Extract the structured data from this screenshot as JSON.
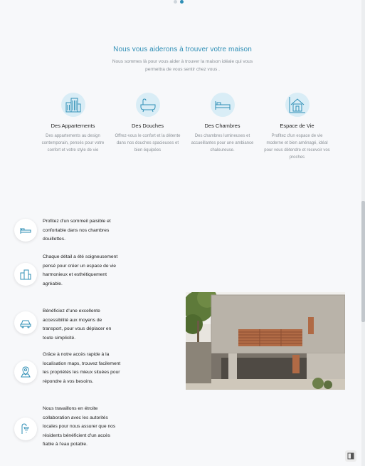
{
  "hero": {
    "title": "Nous vous aiderons à trouver votre maison",
    "subtitle_line1": "Nous sommes là pour vous aider à trouver la maison idéale qui vous",
    "subtitle_line2": "permettra de vous sentir chez vous ."
  },
  "carousel": {
    "dots": 2,
    "active_index": 1
  },
  "features": [
    {
      "icon": "building-icon",
      "title": "Des Appartements",
      "desc": "Des appartements au design contemporain, pensés pour votre confort et votre style de vie"
    },
    {
      "icon": "bathtub-icon",
      "title": "Des Douches",
      "desc": "Offrez-vous le confort et la détente dans nos douches spacieuses et bien équipées"
    },
    {
      "icon": "bed-icon",
      "title": "Des Chambres",
      "desc": "Des chambres lumineuses et accueillantes pour une ambiance chaleureuse."
    },
    {
      "icon": "house-icon",
      "title": "Espace de Vie",
      "desc": "Profitez d'un espace de vie moderne et bien aménagé, idéal pour vous détendre et recevoir vos proches"
    }
  ],
  "info_items": [
    {
      "icon": "bed-icon",
      "text": "Profitez d'un sommeil paisible et confortable dans nos chambres douillettes."
    },
    {
      "icon": "building-icon",
      "text": "Chaque détail a été soigneusement pensé pour créer un espace de vie harmonieux et esthétiquement agréable."
    },
    {
      "icon": "car-icon",
      "text": "Bénéficiez d'une excellente accessibilité aux moyens de transport, pour vous déplacer en toute simplicité."
    },
    {
      "icon": "map-pin-icon",
      "text": "Grâce à notre accès rapide à la localisation maps, trouvez facilement les propriétés les mieux situées pour répondre à vos besoins."
    },
    {
      "icon": "shower-icon",
      "text": "Nous travaillons en étroite collaboration avec les autorités locales pour nous assurer que nos résidents bénéficient d'un accès fiable à l'eau potable."
    }
  ],
  "colors": {
    "accent": "#2f8fb6",
    "icon_bg": "#d9edf6",
    "background": "#f7f8fa"
  }
}
